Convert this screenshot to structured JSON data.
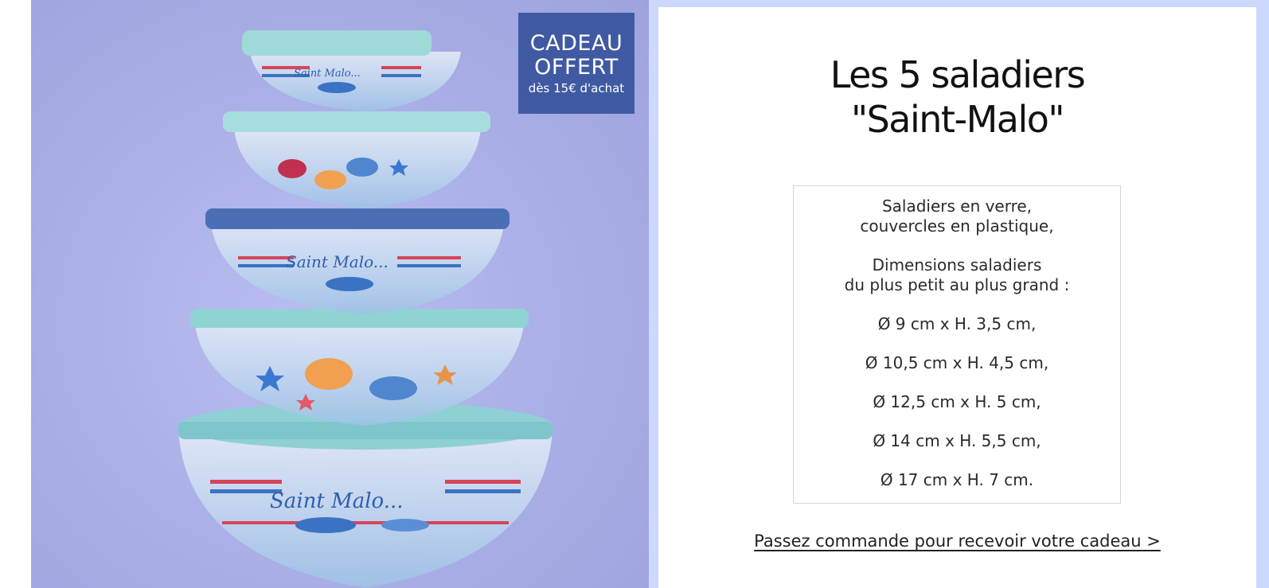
{
  "badge": {
    "line1": "CADEAU",
    "line2": "OFFERT",
    "line3": "dès 15€ d'achat"
  },
  "product": {
    "title_line1": "Les 5 saladiers",
    "title_line2": "\"Saint-Malo\"",
    "bowl_text": "Saint Malo..."
  },
  "specs": {
    "material_line1": "Saladiers en verre,",
    "material_line2": "couvercles en plastique,",
    "dims_heading_line1": "Dimensions saladiers",
    "dims_heading_line2": "du plus petit au plus grand :",
    "sizes": [
      "Ø 9 cm x H. 3,5 cm,",
      "Ø 10,5 cm x H. 4,5 cm,",
      "Ø 12,5 cm x H. 5 cm,",
      "Ø 14 cm x H. 5,5 cm,",
      "Ø 17 cm x H. 7 cm."
    ]
  },
  "cta": {
    "label": "Passez commande pour recevoir votre cadeau >"
  },
  "colors": {
    "background": "#ffffff",
    "panel_bg": "#cdd8ff",
    "badge_bg": "#3f5aa3",
    "photo_bg": "#a9aee6",
    "lid_light": "#8fd0d4",
    "lid_dark": "#4a6fb5"
  }
}
